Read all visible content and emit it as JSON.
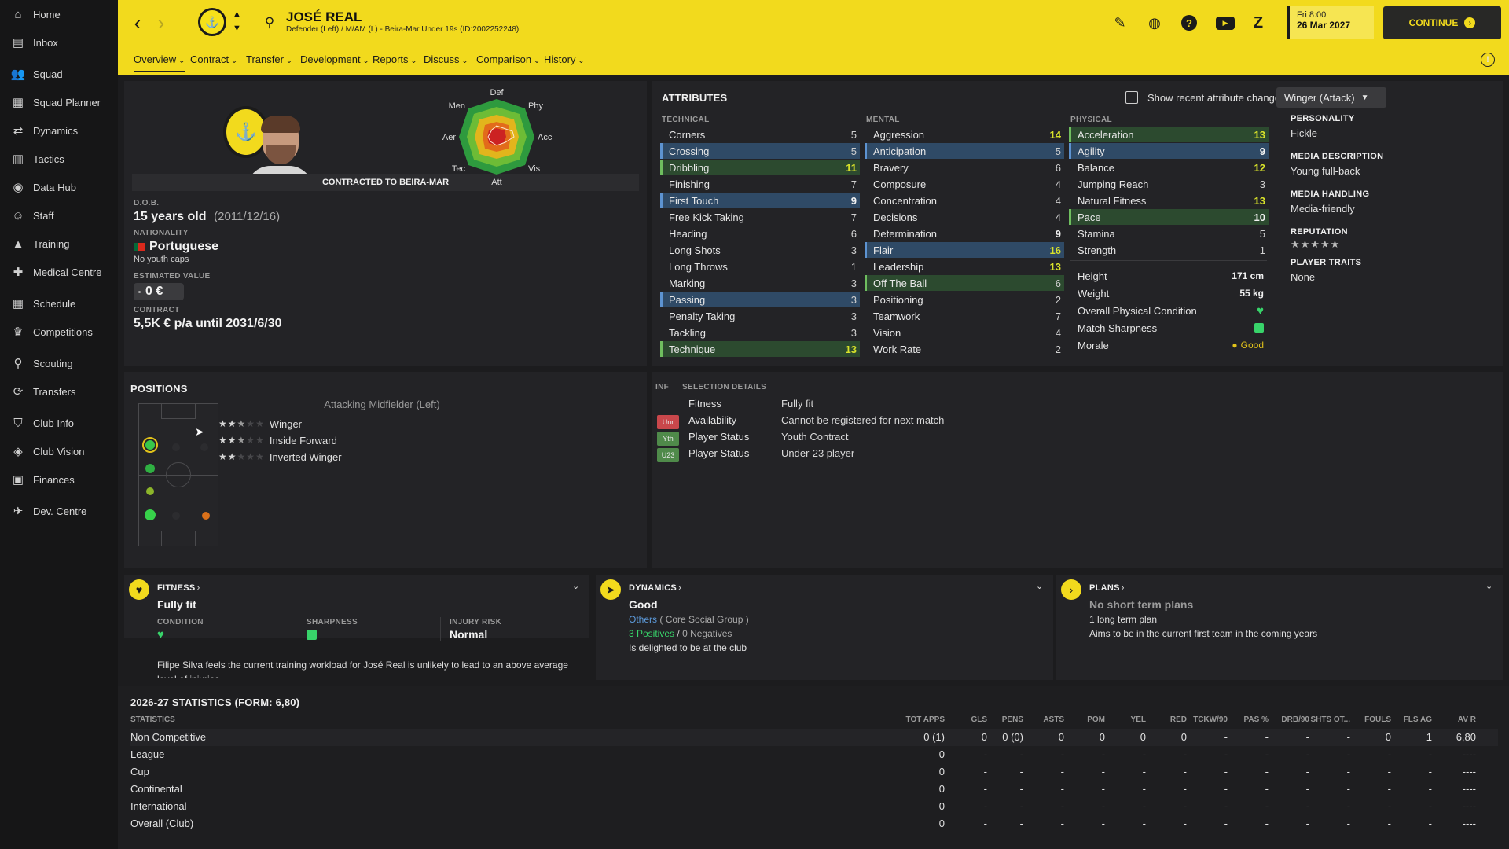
{
  "sidebar": {
    "items": [
      {
        "label": "Home",
        "icon": "home-icon"
      },
      {
        "label": "Inbox",
        "icon": "inbox-icon"
      },
      {
        "label": "Squad",
        "icon": "squad-icon"
      },
      {
        "label": "Squad Planner",
        "icon": "squad-planner-icon"
      },
      {
        "label": "Dynamics",
        "icon": "dynamics-icon"
      },
      {
        "label": "Tactics",
        "icon": "tactics-icon"
      },
      {
        "label": "Data Hub",
        "icon": "data-hub-icon"
      },
      {
        "label": "Staff",
        "icon": "staff-icon"
      },
      {
        "label": "Training",
        "icon": "training-icon"
      },
      {
        "label": "Medical Centre",
        "icon": "medical-icon"
      },
      {
        "label": "Schedule",
        "icon": "schedule-icon"
      },
      {
        "label": "Competitions",
        "icon": "trophy-icon"
      },
      {
        "label": "Scouting",
        "icon": "scouting-icon"
      },
      {
        "label": "Transfers",
        "icon": "transfers-icon"
      },
      {
        "label": "Club Info",
        "icon": "club-info-icon"
      },
      {
        "label": "Club Vision",
        "icon": "club-vision-icon"
      },
      {
        "label": "Finances",
        "icon": "finances-icon"
      },
      {
        "label": "Dev. Centre",
        "icon": "dev-centre-icon"
      }
    ]
  },
  "header": {
    "player_name": "JOSÉ REAL",
    "subtitle": "Defender (Left) / M/AM (L) - Beira-Mar Under 19s (ID:2002252248)",
    "date_day": "Fri 8:00",
    "date": "26 Mar 2027",
    "continue_label": "CONTINUE"
  },
  "nav": {
    "tabs": [
      "Overview",
      "Contract",
      "Transfer",
      "Development",
      "Reports",
      "Discuss",
      "Comparison",
      "History"
    ]
  },
  "profile": {
    "contracted_to": "CONTRACTED TO BEIRA-MAR",
    "dob_label": "D.O.B.",
    "age": "15 years old",
    "dob": "(2011/12/16)",
    "nationality_label": "NATIONALITY",
    "nationality": "Portuguese",
    "youth_caps": "No youth caps",
    "value_label": "ESTIMATED VALUE",
    "value": "0 €",
    "contract_label": "CONTRACT",
    "contract": "5,5K € p/a until 2031/6/30"
  },
  "radar": {
    "labels": [
      "Def",
      "Phy",
      "Acc",
      "Vis",
      "Att",
      "Tec",
      "Aer",
      "Men"
    ]
  },
  "attributes": {
    "title": "ATTRIBUTES",
    "show_changes_label": "Show recent attribute changes",
    "role": "Winger (Attack)",
    "technical_label": "TECHNICAL",
    "mental_label": "MENTAL",
    "physical_label": "PHYSICAL",
    "technical": [
      {
        "name": "Corners",
        "value": "5",
        "hl": ""
      },
      {
        "name": "Crossing",
        "value": "5",
        "hl": "blue"
      },
      {
        "name": "Dribbling",
        "value": "11",
        "hl": "green"
      },
      {
        "name": "Finishing",
        "value": "7",
        "hl": ""
      },
      {
        "name": "First Touch",
        "value": "9",
        "hl": "blue"
      },
      {
        "name": "Free Kick Taking",
        "value": "7",
        "hl": ""
      },
      {
        "name": "Heading",
        "value": "6",
        "hl": ""
      },
      {
        "name": "Long Shots",
        "value": "3",
        "hl": ""
      },
      {
        "name": "Long Throws",
        "value": "1",
        "hl": ""
      },
      {
        "name": "Marking",
        "value": "3",
        "hl": ""
      },
      {
        "name": "Passing",
        "value": "3",
        "hl": "blue"
      },
      {
        "name": "Penalty Taking",
        "value": "3",
        "hl": ""
      },
      {
        "name": "Tackling",
        "value": "3",
        "hl": ""
      },
      {
        "name": "Technique",
        "value": "13",
        "hl": "green"
      }
    ],
    "mental": [
      {
        "name": "Aggression",
        "value": "14",
        "hl": ""
      },
      {
        "name": "Anticipation",
        "value": "5",
        "hl": "blue"
      },
      {
        "name": "Bravery",
        "value": "6",
        "hl": ""
      },
      {
        "name": "Composure",
        "value": "4",
        "hl": ""
      },
      {
        "name": "Concentration",
        "value": "4",
        "hl": ""
      },
      {
        "name": "Decisions",
        "value": "4",
        "hl": ""
      },
      {
        "name": "Determination",
        "value": "9",
        "hl": ""
      },
      {
        "name": "Flair",
        "value": "16",
        "hl": "blue"
      },
      {
        "name": "Leadership",
        "value": "13",
        "hl": ""
      },
      {
        "name": "Off The Ball",
        "value": "6",
        "hl": "green"
      },
      {
        "name": "Positioning",
        "value": "2",
        "hl": ""
      },
      {
        "name": "Teamwork",
        "value": "7",
        "hl": ""
      },
      {
        "name": "Vision",
        "value": "4",
        "hl": ""
      },
      {
        "name": "Work Rate",
        "value": "2",
        "hl": ""
      }
    ],
    "physical": [
      {
        "name": "Acceleration",
        "value": "13",
        "hl": "green"
      },
      {
        "name": "Agility",
        "value": "9",
        "hl": "blue"
      },
      {
        "name": "Balance",
        "value": "12",
        "hl": ""
      },
      {
        "name": "Jumping Reach",
        "value": "3",
        "hl": ""
      },
      {
        "name": "Natural Fitness",
        "value": "13",
        "hl": ""
      },
      {
        "name": "Pace",
        "value": "10",
        "hl": "green"
      },
      {
        "name": "Stamina",
        "value": "5",
        "hl": ""
      },
      {
        "name": "Strength",
        "value": "1",
        "hl": ""
      }
    ],
    "extra": [
      {
        "name": "Height",
        "value": "171 cm"
      },
      {
        "name": "Weight",
        "value": "55 kg"
      },
      {
        "name": "Overall Physical Condition",
        "value": ""
      },
      {
        "name": "Match Sharpness",
        "value": ""
      },
      {
        "name": "Morale",
        "value": "Good"
      }
    ]
  },
  "info": {
    "personality_label": "PERSONALITY",
    "personality": "Fickle",
    "media_desc_label": "MEDIA DESCRIPTION",
    "media_desc": "Young full-back",
    "media_handling_label": "MEDIA HANDLING",
    "media_handling": "Media-friendly",
    "reputation_label": "REPUTATION",
    "traits_label": "PLAYER TRAITS",
    "traits": "None"
  },
  "positions": {
    "title": "POSITIONS",
    "main": "Attacking Midfielder (Left)",
    "roles": [
      {
        "name": "Winger",
        "stars": 2.5
      },
      {
        "name": "Inside Forward",
        "stars": 2.5
      },
      {
        "name": "Inverted Winger",
        "stars": 2
      }
    ]
  },
  "selection": {
    "inf_label": "INF",
    "title": "SELECTION DETAILS",
    "rows": [
      {
        "tag": "",
        "tag_color": "",
        "label": "Fitness",
        "value": "Fully fit"
      },
      {
        "tag": "Unr",
        "tag_color": "#c9474b",
        "label": "Availability",
        "value": "Cannot be registered for next match"
      },
      {
        "tag": "Yth",
        "tag_color": "#4f8a4a",
        "label": "Player Status",
        "value": "Youth Contract"
      },
      {
        "tag": "U23",
        "tag_color": "#4f8a4a",
        "label": "Player Status",
        "value": "Under-23 player"
      }
    ]
  },
  "fitness": {
    "title": "FITNESS",
    "status": "Fully fit",
    "condition_label": "CONDITION",
    "sharpness_label": "SHARPNESS",
    "injury_label": "INJURY RISK",
    "injury": "Normal",
    "note": "Filipe Silva feels the current training workload for José Real is unlikely to lead to an above average level of injuries"
  },
  "dynamics": {
    "title": "DYNAMICS",
    "status": "Good",
    "group_link": "Others",
    "group": "( Core Social Group )",
    "positives": "3 Positives",
    "sep": "/",
    "negatives": "0 Negatives",
    "note": "Is delighted to be at the club"
  },
  "plans": {
    "title": "PLANS",
    "short": "No short term plans",
    "long": "1 long term plan",
    "note": "Aims to be in the current first team in the coming years"
  },
  "stats": {
    "title": "2026-27 STATISTICS (FORM: 6,80)",
    "label": "STATISTICS",
    "headers": [
      "TOT APPS",
      "GLS",
      "PENS",
      "ASTS",
      "POM",
      "YEL",
      "RED",
      "TCKW/90",
      "PAS %",
      "DRB/90",
      "SHTS OT...",
      "FOULS",
      "FLS AG",
      "AV R"
    ],
    "rows": [
      {
        "name": "Non Competitive",
        "cells": [
          "0 (1)",
          "0",
          "0 (0)",
          "0",
          "0",
          "0",
          "0",
          "-",
          "-",
          "-",
          "-",
          "0",
          "1",
          "6,80"
        ]
      },
      {
        "name": "League",
        "cells": [
          "0",
          "-",
          "-",
          "-",
          "-",
          "-",
          "-",
          "-",
          "-",
          "-",
          "-",
          "-",
          "-",
          "----"
        ]
      },
      {
        "name": "Cup",
        "cells": [
          "0",
          "-",
          "-",
          "-",
          "-",
          "-",
          "-",
          "-",
          "-",
          "-",
          "-",
          "-",
          "-",
          "----"
        ]
      },
      {
        "name": "Continental",
        "cells": [
          "0",
          "-",
          "-",
          "-",
          "-",
          "-",
          "-",
          "-",
          "-",
          "-",
          "-",
          "-",
          "-",
          "----"
        ]
      },
      {
        "name": "International",
        "cells": [
          "0",
          "-",
          "-",
          "-",
          "-",
          "-",
          "-",
          "-",
          "-",
          "-",
          "-",
          "-",
          "-",
          "----"
        ]
      },
      {
        "name": "Overall (Club)",
        "cells": [
          "0",
          "-",
          "-",
          "-",
          "-",
          "-",
          "-",
          "-",
          "-",
          "-",
          "-",
          "-",
          "-",
          "----"
        ]
      }
    ]
  },
  "colors": {
    "accent": "#f2da1d",
    "good": "#38d36a",
    "blue_hl": "#2f4a66",
    "green_hl": "#2c4a2f"
  }
}
